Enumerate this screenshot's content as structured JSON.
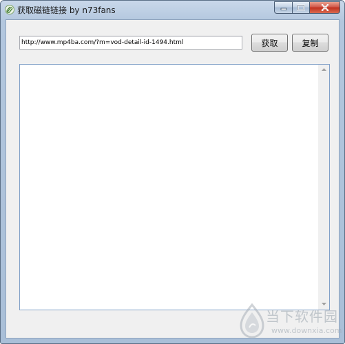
{
  "window": {
    "title": "获取磁链链接 by n73fans",
    "icon": "paperclip-icon"
  },
  "controls": {
    "minimize": "minimize-icon",
    "maximize": "maximize-icon",
    "close": "close-icon"
  },
  "form": {
    "url_value": "http://www.mp4ba.com/?m=vod-detail-id-1494.html",
    "fetch_label": "获取",
    "copy_label": "复制",
    "output_value": ""
  },
  "watermark": {
    "cn_text": "当下软件园",
    "en_text": "www.downxia.com"
  },
  "colors": {
    "close_button": "#c1301e",
    "frame": "#a9bfd8"
  }
}
